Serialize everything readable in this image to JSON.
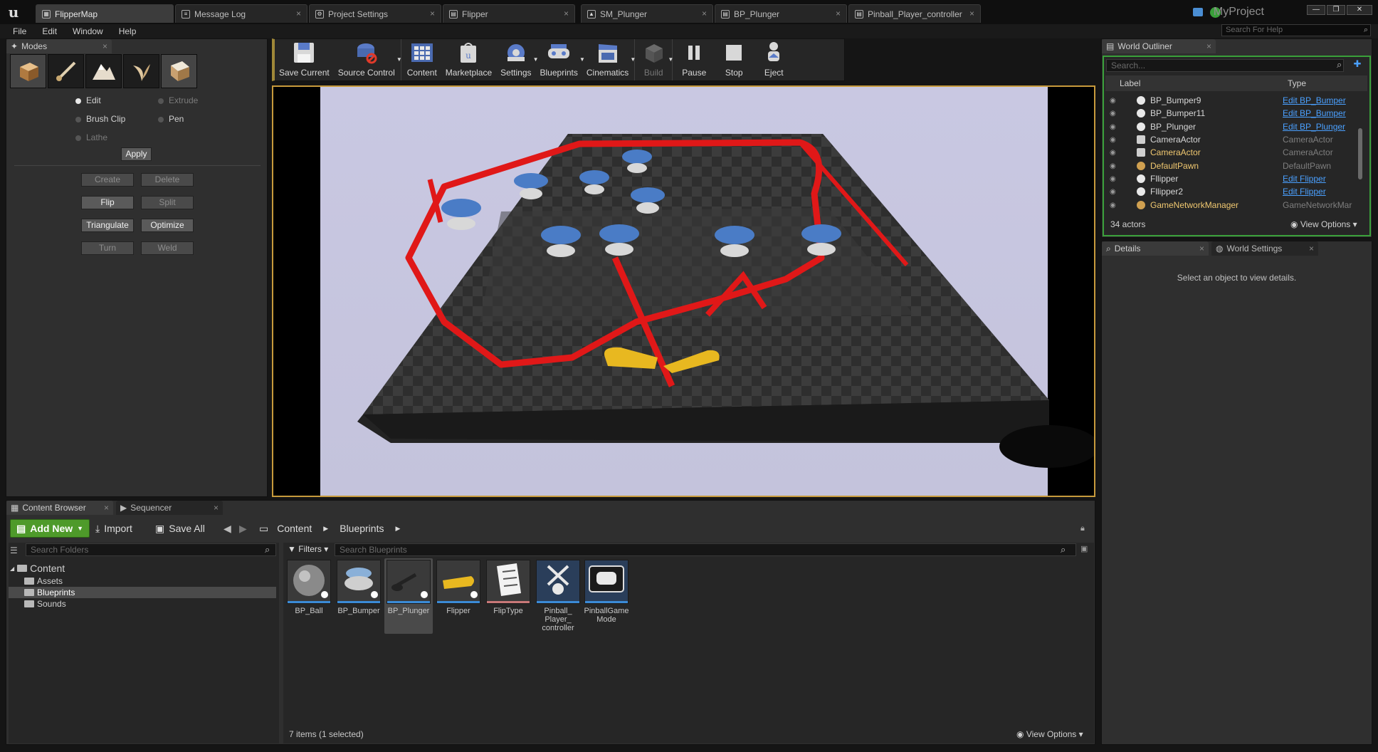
{
  "app": {
    "project": "MyProject",
    "help_search_placeholder": "Search For Help"
  },
  "tabs": [
    "FlipperMap",
    "Message Log",
    "Project Settings",
    "Flipper",
    "SM_Plunger",
    "BP_Plunger",
    "Pinball_Player_controller"
  ],
  "menu": [
    "File",
    "Edit",
    "Window",
    "Help"
  ],
  "modes": {
    "title": "Modes",
    "icons": [
      "place-mode-icon",
      "paint-mode-icon",
      "landscape-mode-icon",
      "foliage-mode-icon",
      "geometry-mode-icon"
    ],
    "radio": {
      "edit": "Edit",
      "extrude": "Extrude",
      "brush_clip": "Brush Clip",
      "pen": "Pen",
      "lathe": "Lathe"
    },
    "apply": "Apply",
    "buttons": {
      "create": "Create",
      "delete": "Delete",
      "flip": "Flip",
      "split": "Split",
      "triangulate": "Triangulate",
      "optimize": "Optimize",
      "turn": "Turn",
      "weld": "Weld"
    }
  },
  "toolbar": {
    "save_current": "Save Current",
    "source_control": "Source Control",
    "content": "Content",
    "marketplace": "Marketplace",
    "settings": "Settings",
    "blueprints": "Blueprints",
    "cinematics": "Cinematics",
    "build": "Build",
    "pause": "Pause",
    "stop": "Stop",
    "eject": "Eject"
  },
  "outliner": {
    "title": "World Outliner",
    "search_placeholder": "Search...",
    "col_label": "Label",
    "col_type": "Type",
    "rows": [
      {
        "label": "BP_Bumper9",
        "type": "Edit BP_Bumper"
      },
      {
        "label": "BP_Bumper11",
        "type": "Edit BP_Bumper"
      },
      {
        "label": "BP_Plunger",
        "type": "Edit BP_Plunger"
      },
      {
        "label": "CameraActor",
        "type": "CameraActor"
      },
      {
        "label": "CameraActor",
        "type": "CameraActor"
      },
      {
        "label": "DefaultPawn",
        "type": "DefaultPawn"
      },
      {
        "label": "Fllipper",
        "type": "Edit Flipper"
      },
      {
        "label": "Fllipper2",
        "type": "Edit Flipper"
      },
      {
        "label": "GameNetworkManager",
        "type": "GameNetworkMar"
      }
    ],
    "count": "34 actors",
    "view_options": "View Options"
  },
  "details": {
    "tab": "Details",
    "world_settings_tab": "World Settings",
    "empty": "Select an object to view details."
  },
  "content_browser": {
    "tab": "Content Browser",
    "sequencer_tab": "Sequencer",
    "add_new": "Add New",
    "import": "Import",
    "save_all": "Save All",
    "path": [
      "Content",
      "Blueprints"
    ],
    "search_folders": "Search Folders",
    "filters": "Filters",
    "search_assets": "Search Blueprints",
    "tree_root": "Content",
    "folders": [
      "Assets",
      "Blueprints",
      "Sounds"
    ],
    "assets": [
      "BP_Ball",
      "BP_Bumper",
      "BP_Plunger",
      "Flipper",
      "FlipType",
      "Pinball_ Player_ controller",
      "PinballGame Mode"
    ],
    "status": "7 items (1 selected)",
    "view_options": "View Options"
  }
}
